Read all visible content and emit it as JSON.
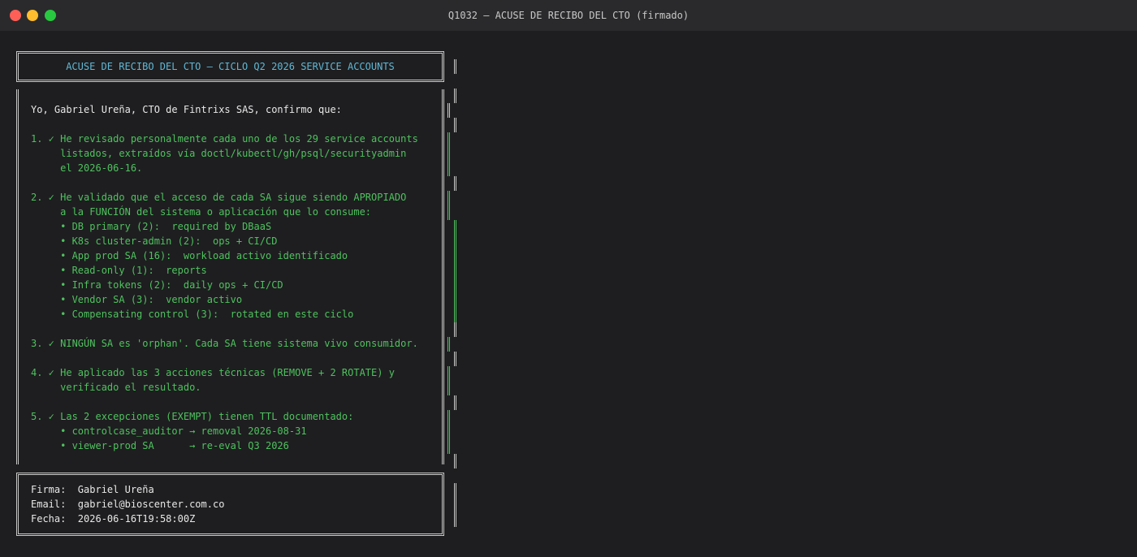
{
  "window": {
    "title": "Q1032 — ACUSE DE RECIBO DEL CTO (firmado)"
  },
  "document": {
    "header": "ACUSE DE RECIBO DEL CTO — CICLO Q2 2026 SERVICE ACCOUNTS",
    "intro": "Yo, Gabriel Ureña, CTO de Fintrixs SAS, confirmo que:",
    "items": [
      {
        "lines": [
          "1. ✓ He revisado personalmente cada uno de los 29 service accounts",
          "     listados, extraídos vía doctl/kubectl/gh/psql/securityadmin",
          "     el 2026-06-16."
        ]
      },
      {
        "lines": [
          "2. ✓ He validado que el acceso de cada SA sigue siendo APROPIADO",
          "     a la FUNCIÓN del sistema o aplicación que lo consume:",
          "     • DB primary (2):  required by DBaaS",
          "     • K8s cluster-admin (2):  ops + CI/CD",
          "     • App prod SA (16):  workload activo identificado",
          "     • Read-only (1):  reports",
          "     • Infra tokens (2):  daily ops + CI/CD",
          "     • Vendor SA (3):  vendor activo",
          "     • Compensating control (3):  rotated en este ciclo"
        ]
      },
      {
        "lines": [
          "3. ✓ NINGÚN SA es 'orphan'. Cada SA tiene sistema vivo consumidor."
        ]
      },
      {
        "lines": [
          "4. ✓ He aplicado las 3 acciones técnicas (REMOVE + 2 ROTATE) y",
          "     verificado el resultado."
        ]
      },
      {
        "lines": [
          "5. ✓ Las 2 excepciones (EXEMPT) tienen TTL documentado:",
          "     • controlcase_auditor → removal 2026-08-31",
          "     • viewer-prod SA      → re-eval Q3 2026"
        ]
      }
    ],
    "signature": {
      "firma": "Firma:  Gabriel Ureña",
      "email": "Email:  gabriel@bioscenter.com.co",
      "fecha": "Fecha:  2026-06-16T19:58:00Z"
    }
  },
  "colors": {
    "background": "#1e1e20",
    "titlebar": "#2a2a2c",
    "header_text": "#5fb8d6",
    "check_text": "#4ec25e",
    "plain_text": "#e8e8e8",
    "border": "#c8c8c8"
  }
}
